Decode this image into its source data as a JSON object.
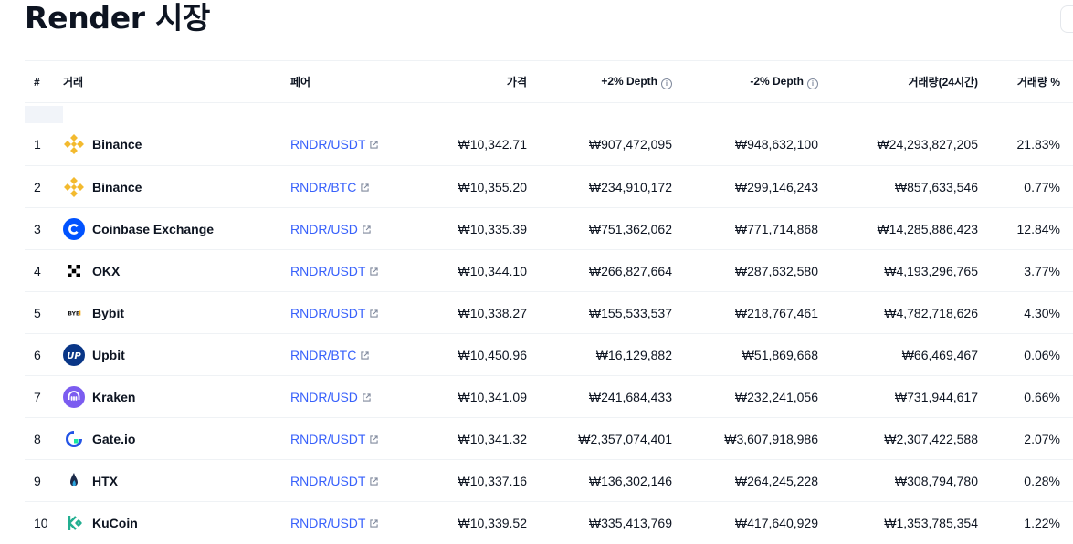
{
  "page": {
    "title": "Render 시장"
  },
  "table": {
    "headers": {
      "rank": "#",
      "exchange": "거래",
      "pair": "페어",
      "price": "가격",
      "plus_depth": "+2% Depth",
      "minus_depth": "-2% Depth",
      "volume_24h": "거래량(24시간)",
      "volume_pct": "거래량 %"
    },
    "rows": [
      {
        "rank": "1",
        "exchange": "Binance",
        "logo": "binance-logo",
        "pair": "RNDR/USDT",
        "price": "₩10,342.71",
        "plus_depth": "₩907,472,095",
        "minus_depth": "₩948,632,100",
        "volume": "₩24,293,827,205",
        "volume_pct": "21.83%"
      },
      {
        "rank": "2",
        "exchange": "Binance",
        "logo": "binance-logo",
        "pair": "RNDR/BTC",
        "price": "₩10,355.20",
        "plus_depth": "₩234,910,172",
        "minus_depth": "₩299,146,243",
        "volume": "₩857,633,546",
        "volume_pct": "0.77%"
      },
      {
        "rank": "3",
        "exchange": "Coinbase Exchange",
        "logo": "coinbase-logo",
        "pair": "RNDR/USD",
        "price": "₩10,335.39",
        "plus_depth": "₩751,362,062",
        "minus_depth": "₩771,714,868",
        "volume": "₩14,285,886,423",
        "volume_pct": "12.84%"
      },
      {
        "rank": "4",
        "exchange": "OKX",
        "logo": "okx-logo",
        "pair": "RNDR/USDT",
        "price": "₩10,344.10",
        "plus_depth": "₩266,827,664",
        "minus_depth": "₩287,632,580",
        "volume": "₩4,193,296,765",
        "volume_pct": "3.77%"
      },
      {
        "rank": "5",
        "exchange": "Bybit",
        "logo": "bybit-logo",
        "pair": "RNDR/USDT",
        "price": "₩10,338.27",
        "plus_depth": "₩155,533,537",
        "minus_depth": "₩218,767,461",
        "volume": "₩4,782,718,626",
        "volume_pct": "4.30%"
      },
      {
        "rank": "6",
        "exchange": "Upbit",
        "logo": "upbit-logo",
        "pair": "RNDR/BTC",
        "price": "₩10,450.96",
        "plus_depth": "₩16,129,882",
        "minus_depth": "₩51,869,668",
        "volume": "₩66,469,467",
        "volume_pct": "0.06%"
      },
      {
        "rank": "7",
        "exchange": "Kraken",
        "logo": "kraken-logo",
        "pair": "RNDR/USD",
        "price": "₩10,341.09",
        "plus_depth": "₩241,684,433",
        "minus_depth": "₩232,241,056",
        "volume": "₩731,944,617",
        "volume_pct": "0.66%"
      },
      {
        "rank": "8",
        "exchange": "Gate.io",
        "logo": "gateio-logo",
        "pair": "RNDR/USDT",
        "price": "₩10,341.32",
        "plus_depth": "₩2,357,074,401",
        "minus_depth": "₩3,607,918,986",
        "volume": "₩2,307,422,588",
        "volume_pct": "2.07%"
      },
      {
        "rank": "9",
        "exchange": "HTX",
        "logo": "htx-logo",
        "pair": "RNDR/USDT",
        "price": "₩10,337.16",
        "plus_depth": "₩136,302,146",
        "minus_depth": "₩264,245,228",
        "volume": "₩308,794,780",
        "volume_pct": "0.28%"
      },
      {
        "rank": "10",
        "exchange": "KuCoin",
        "logo": "kucoin-logo",
        "pair": "RNDR/USDT",
        "price": "₩10,339.52",
        "plus_depth": "₩335,413,769",
        "minus_depth": "₩417,640,929",
        "volume": "₩1,353,785,354",
        "volume_pct": "1.22%"
      }
    ]
  },
  "colors": {
    "link": "#3861fb",
    "border": "#eff2f5",
    "text": "#0d1421",
    "muted": "#808a9d"
  }
}
